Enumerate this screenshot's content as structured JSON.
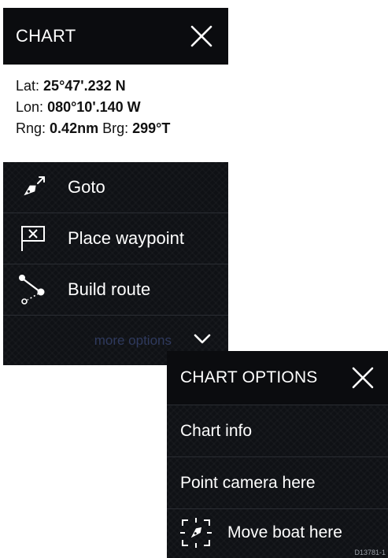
{
  "chart_panel": {
    "title": "CHART",
    "close_icon": "close-icon",
    "position": {
      "lat_label": "Lat:",
      "lat_value": "25°47'.232 N",
      "lon_label": "Lon:",
      "lon_value": "080°10'.140 W",
      "rng_label": "Rng:",
      "rng_value": "0.42nm",
      "brg_label": "Brg:",
      "brg_value": "299°T"
    },
    "menu_items": [
      {
        "label": "Goto",
        "icon": "goto-boat-arrow-icon"
      },
      {
        "label": "Place waypoint",
        "icon": "waypoint-flag-icon"
      },
      {
        "label": "Build route",
        "icon": "route-icon"
      }
    ],
    "more_options_label": "more options",
    "more_options_icon": "chevron-down-icon"
  },
  "options_panel": {
    "title": "CHART OPTIONS",
    "close_icon": "close-icon",
    "items": [
      {
        "label": "Chart info"
      },
      {
        "label": "Point camera here"
      },
      {
        "label": "Move boat here",
        "icon": "move-boat-icon"
      }
    ],
    "reference_code": "D13781-1"
  },
  "colors": {
    "panel_bg": "#0f1115",
    "header_bg": "#0b0c0f",
    "info_bg": "#ffffff",
    "text": "#ffffff",
    "more_options_text": "#2f3a5e",
    "divider": "#2a2d33"
  }
}
